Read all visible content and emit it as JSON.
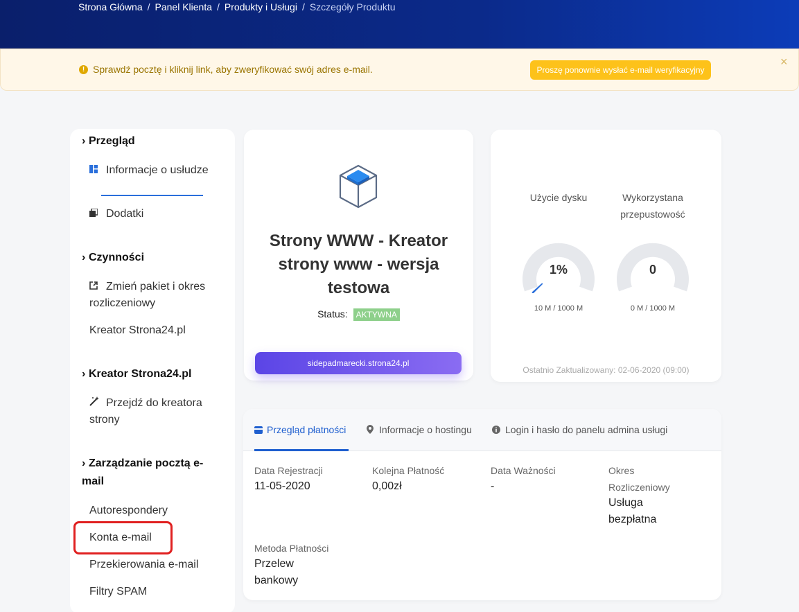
{
  "breadcrumb": [
    "Strona Główna",
    "Panel Klienta",
    "Produkty i Usługi",
    "Szczegóły Produktu"
  ],
  "alert": {
    "text": "Sprawdź pocztę i kliknij link, aby zweryfikować swój adres e-mail.",
    "button": "Proszę ponownie wysłać e-mail weryfikacyjny",
    "close": "×"
  },
  "sidebar": {
    "sections": [
      {
        "title": "Przegląd",
        "items": [
          "Informacje o usłudze",
          "Dodatki"
        ]
      },
      {
        "title": "Czynności",
        "items": [
          "Zmień pakiet i okres rozliczeniowy",
          "Kreator Strona24.pl"
        ]
      },
      {
        "title": "Kreator Strona24.pl",
        "items": [
          "Przejdź do kreatora strony"
        ]
      },
      {
        "title": "Zarządzanie pocztą e-mail",
        "items": [
          "Autorespondery",
          "Konta e-mail",
          "Przekierowania e-mail",
          "Filtry SPAM"
        ]
      }
    ]
  },
  "product": {
    "title": "Strony WWW - Kreator strony www - wersja testowa",
    "status_label": "Status:",
    "status": "AKTYWNA",
    "domain": "sidepadmarecki.strona24.pl"
  },
  "usage": {
    "disk": {
      "label": "Użycie dysku",
      "value": "1%",
      "detail": "10 M / 1000 M",
      "fraction": 0.01
    },
    "bandwidth": {
      "label": "Wykorzystana przepustowość",
      "value": "0",
      "detail": "0 M / 1000 M",
      "fraction": 0
    },
    "updated": "Ostatnio Zaktualizowany: 02-06-2020 (09:00)"
  },
  "payment": {
    "tabs": [
      "Przegląd płatności",
      "Informacje o hostingu",
      "Login i hasło do panelu admina usługi"
    ],
    "fields": [
      {
        "label": "Data Rejestracji",
        "value": "11-05-2020"
      },
      {
        "label": "Kolejna Płatność",
        "value": "0,00zł"
      },
      {
        "label": "Data Ważności",
        "value": "-"
      },
      {
        "label": "Okres Rozliczeniowy",
        "value": "Usługa bezpłatna"
      },
      {
        "label": "Metoda Płatności",
        "value": "Przelew bankowy"
      }
    ]
  },
  "colors": {
    "accent": "#1f5fcf",
    "warning": "#fdc21a",
    "status_active": "#8ed08b",
    "highlight": "#e02020"
  }
}
